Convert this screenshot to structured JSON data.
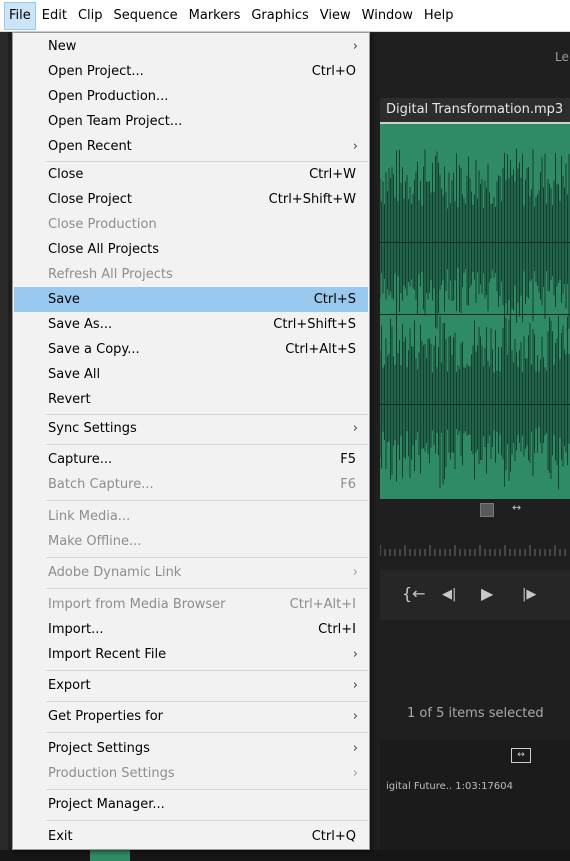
{
  "menubar": {
    "items": [
      "File",
      "Edit",
      "Clip",
      "Sequence",
      "Markers",
      "Graphics",
      "View",
      "Window",
      "Help"
    ]
  },
  "background": {
    "clip_title": "Digital Transformation.mp3",
    "top_right_partial": "Le",
    "items_selected": "1 of 5 items selected",
    "clip_info": "igital Future.. 1:03:17604"
  },
  "file_menu": {
    "items": [
      {
        "label": "New",
        "shortcut": "",
        "submenu": true,
        "disabled": false
      },
      {
        "label": "Open Project...",
        "shortcut": "Ctrl+O",
        "submenu": false,
        "disabled": false
      },
      {
        "label": "Open Production...",
        "shortcut": "",
        "submenu": false,
        "disabled": false
      },
      {
        "label": "Open Team Project...",
        "shortcut": "",
        "submenu": false,
        "disabled": false
      },
      {
        "label": "Open Recent",
        "shortcut": "",
        "submenu": true,
        "disabled": false
      },
      {
        "label": "Close",
        "shortcut": "Ctrl+W",
        "submenu": false,
        "disabled": false
      },
      {
        "label": "Close Project",
        "shortcut": "Ctrl+Shift+W",
        "submenu": false,
        "disabled": false
      },
      {
        "label": "Close Production",
        "shortcut": "",
        "submenu": false,
        "disabled": true
      },
      {
        "label": "Close All Projects",
        "shortcut": "",
        "submenu": false,
        "disabled": false
      },
      {
        "label": "Refresh All Projects",
        "shortcut": "",
        "submenu": false,
        "disabled": true
      },
      {
        "label": "Save",
        "shortcut": "Ctrl+S",
        "submenu": false,
        "disabled": false,
        "highlighted": true
      },
      {
        "label": "Save As...",
        "shortcut": "Ctrl+Shift+S",
        "submenu": false,
        "disabled": false
      },
      {
        "label": "Save a Copy...",
        "shortcut": "Ctrl+Alt+S",
        "submenu": false,
        "disabled": false
      },
      {
        "label": "Save All",
        "shortcut": "",
        "submenu": false,
        "disabled": false
      },
      {
        "label": "Revert",
        "shortcut": "",
        "submenu": false,
        "disabled": false
      },
      {
        "label": "Sync Settings",
        "shortcut": "",
        "submenu": true,
        "disabled": false
      },
      {
        "label": "Capture...",
        "shortcut": "F5",
        "submenu": false,
        "disabled": false
      },
      {
        "label": "Batch Capture...",
        "shortcut": "F6",
        "submenu": false,
        "disabled": true
      },
      {
        "label": "Link Media...",
        "shortcut": "",
        "submenu": false,
        "disabled": true
      },
      {
        "label": "Make Offline...",
        "shortcut": "",
        "submenu": false,
        "disabled": true
      },
      {
        "label": "Adobe Dynamic Link",
        "shortcut": "",
        "submenu": true,
        "disabled": true
      },
      {
        "label": "Import from Media Browser",
        "shortcut": "Ctrl+Alt+I",
        "submenu": false,
        "disabled": true
      },
      {
        "label": "Import...",
        "shortcut": "Ctrl+I",
        "submenu": false,
        "disabled": false
      },
      {
        "label": "Import Recent File",
        "shortcut": "",
        "submenu": true,
        "disabled": false
      },
      {
        "label": "Export",
        "shortcut": "",
        "submenu": true,
        "disabled": false
      },
      {
        "label": "Get Properties for",
        "shortcut": "",
        "submenu": true,
        "disabled": false
      },
      {
        "label": "Project Settings",
        "shortcut": "",
        "submenu": true,
        "disabled": false
      },
      {
        "label": "Production Settings",
        "shortcut": "",
        "submenu": true,
        "disabled": true
      },
      {
        "label": "Project Manager...",
        "shortcut": "",
        "submenu": false,
        "disabled": false
      },
      {
        "label": "Exit",
        "shortcut": "Ctrl+Q",
        "submenu": false,
        "disabled": false
      }
    ],
    "submenu_icon": "chevron-right-icon"
  },
  "colors": {
    "highlight": "#99c9ef",
    "waveform": "#2f8a66",
    "disabled_text": "#8d8d8d"
  }
}
